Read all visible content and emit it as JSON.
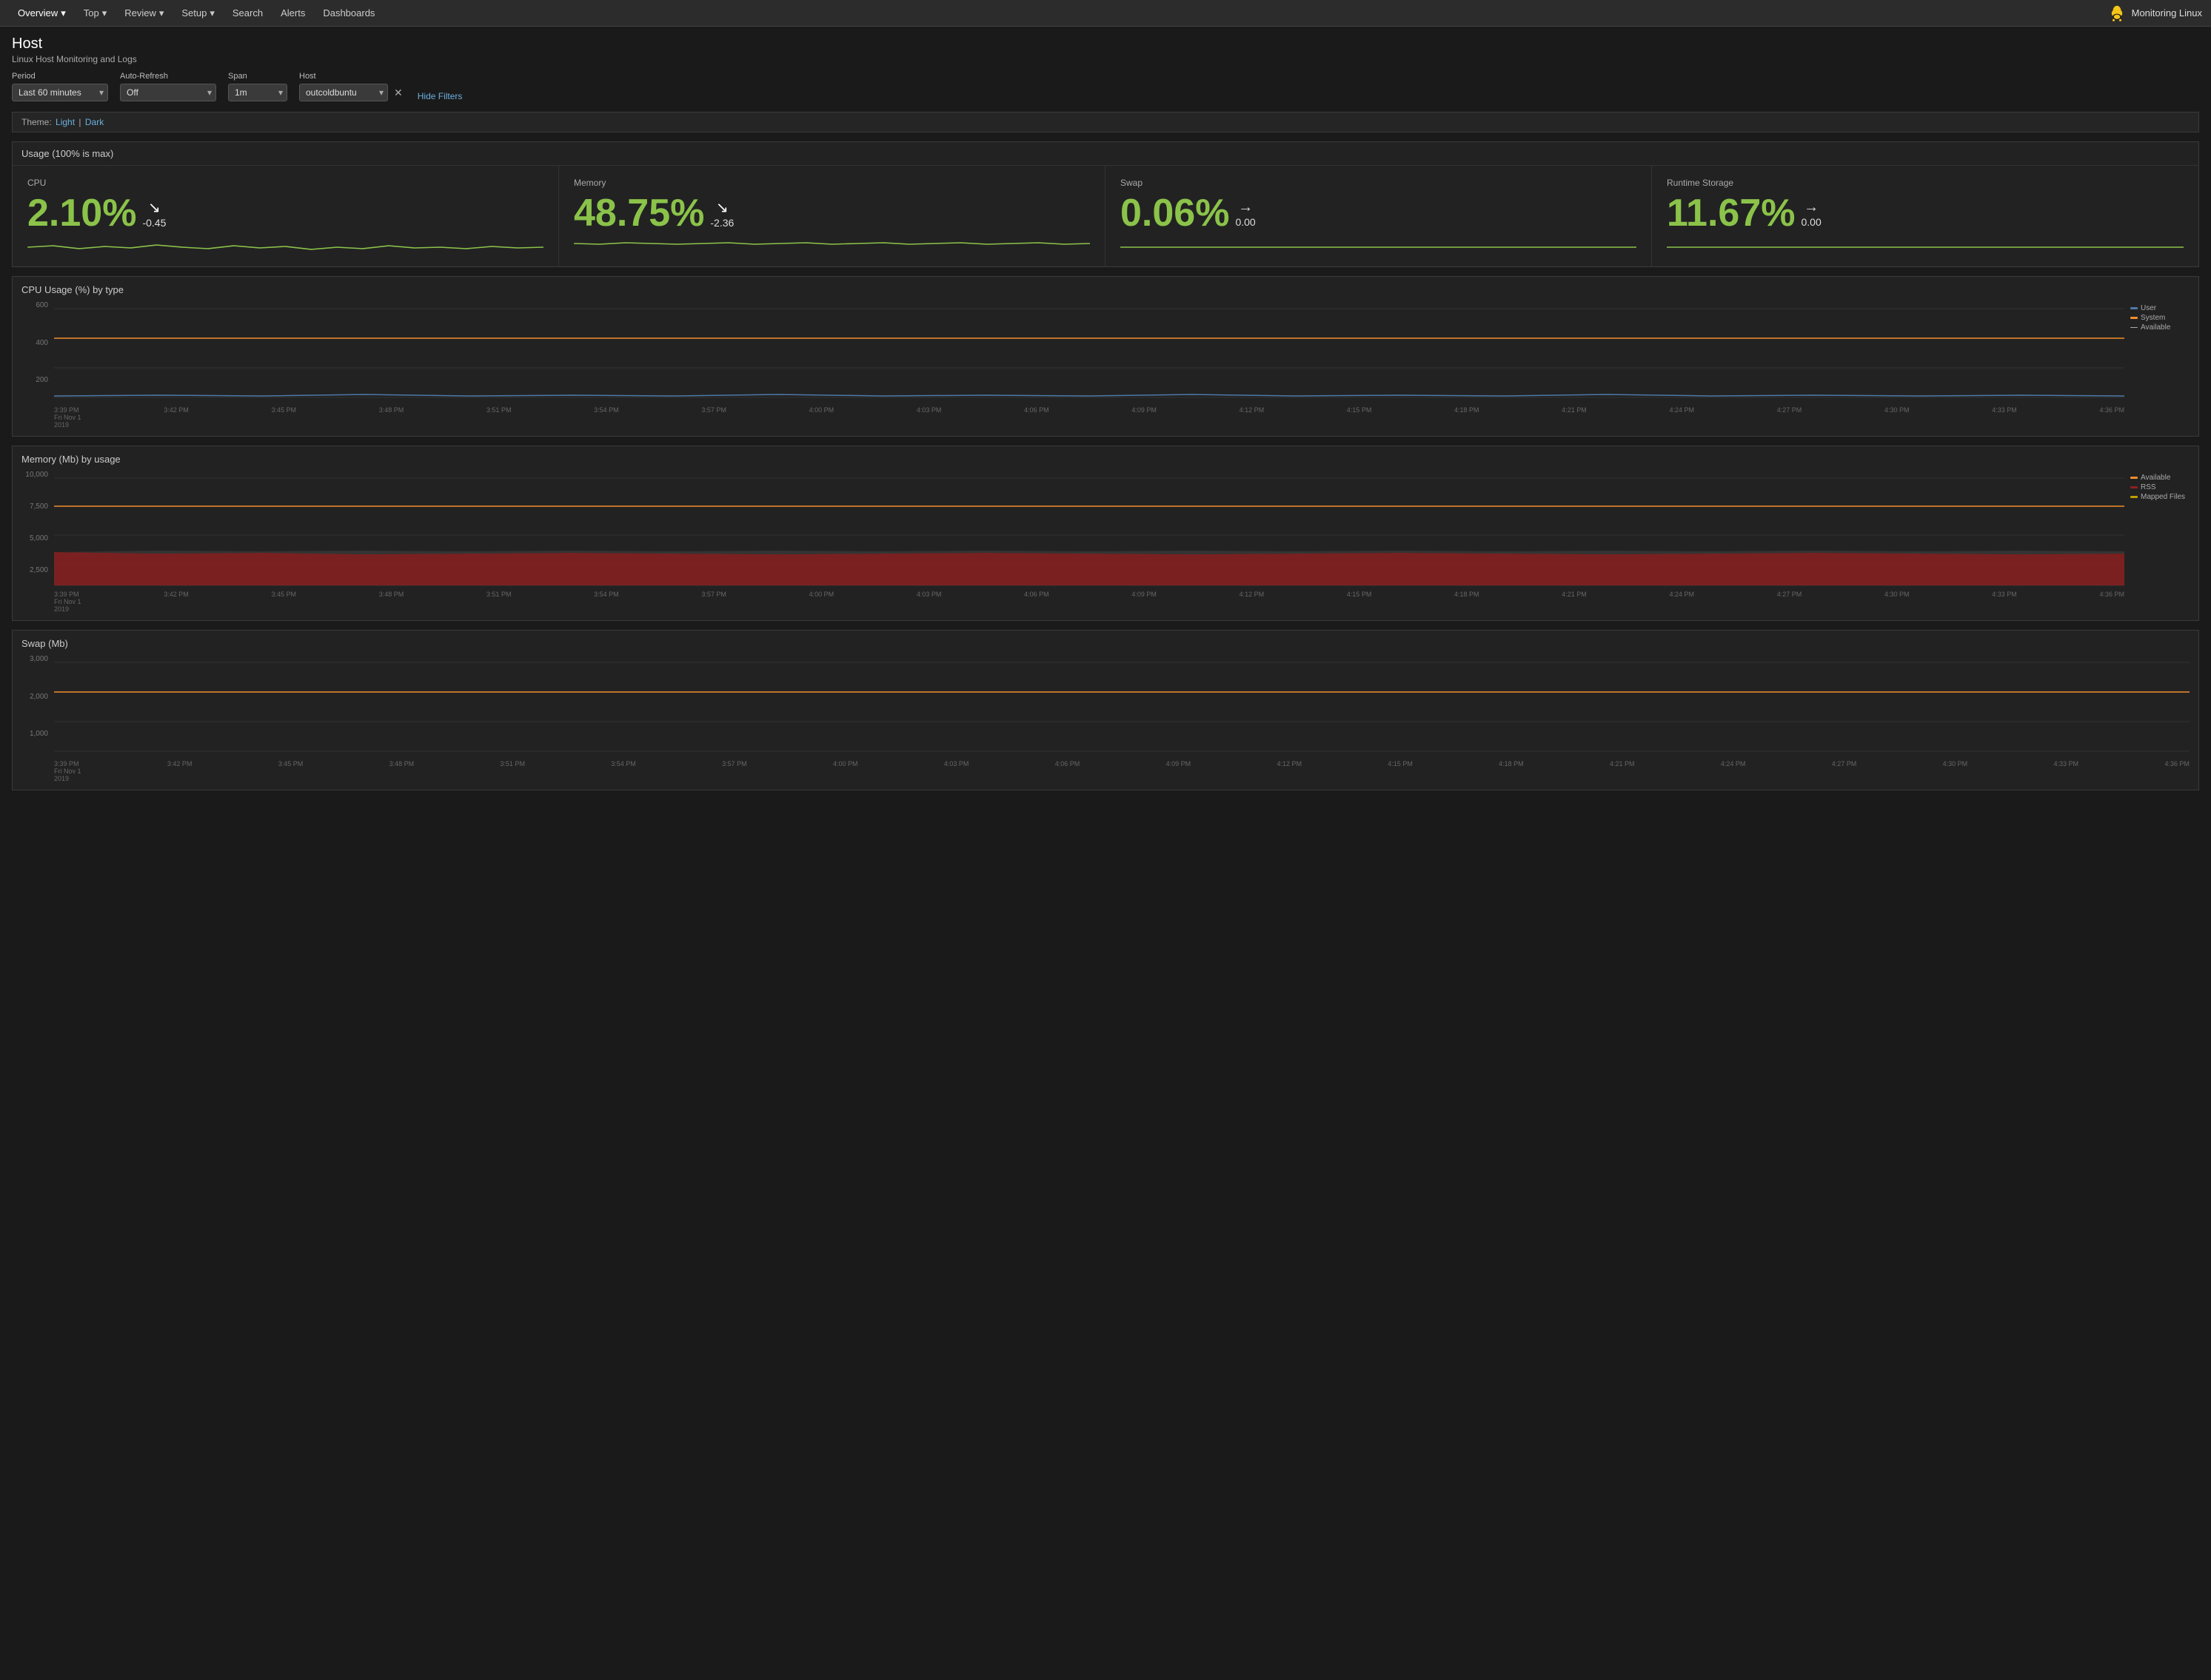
{
  "nav": {
    "items": [
      {
        "label": "Overview",
        "has_arrow": true
      },
      {
        "label": "Top",
        "has_arrow": true
      },
      {
        "label": "Review",
        "has_arrow": true
      },
      {
        "label": "Setup",
        "has_arrow": true
      },
      {
        "label": "Search",
        "has_arrow": false
      },
      {
        "label": "Alerts",
        "has_arrow": false
      },
      {
        "label": "Dashboards",
        "has_arrow": false
      }
    ],
    "brand_label": "Monitoring Linux"
  },
  "page": {
    "title": "Host",
    "subtitle": "Linux Host Monitoring and Logs"
  },
  "filters": {
    "period_label": "Period",
    "period_value": "Last 60 minutes",
    "autorefresh_label": "Auto-Refresh",
    "autorefresh_value": "Off",
    "span_label": "Span",
    "span_value": "1m",
    "host_label": "Host",
    "host_value": "outcoldbuntu",
    "hide_filters": "Hide Filters"
  },
  "theme": {
    "label": "Theme:",
    "light": "Light",
    "separator": "|",
    "dark": "Dark"
  },
  "usage": {
    "title": "Usage (100% is max)",
    "cells": [
      {
        "label": "CPU",
        "value": "2.10%",
        "delta": "-0.45",
        "arrow": "↘"
      },
      {
        "label": "Memory",
        "value": "48.75%",
        "delta": "-2.36",
        "arrow": "↘"
      },
      {
        "label": "Swap",
        "value": "0.06%",
        "delta": "0.00",
        "arrow": "→"
      },
      {
        "label": "Runtime Storage",
        "value": "11.67%",
        "delta": "0.00",
        "arrow": "→"
      }
    ]
  },
  "cpu_chart": {
    "title": "CPU Usage (%) by type",
    "y_labels": [
      "600",
      "400",
      "200",
      ""
    ],
    "x_labels": [
      "3:39 PM\nFri Nov 1\n2019",
      "3:42 PM",
      "3:45 PM",
      "3:48 PM",
      "3:51 PM",
      "3:54 PM",
      "3:57 PM",
      "4:00 PM",
      "4:03 PM",
      "4:06 PM",
      "4:09 PM",
      "4:12 PM",
      "4:15 PM",
      "4:18 PM",
      "4:21 PM",
      "4:24 PM",
      "4:27 PM",
      "4:30 PM",
      "4:33 PM",
      "4:36 PM"
    ],
    "legend": [
      {
        "label": "User",
        "color": "#4e79a7"
      },
      {
        "label": "System",
        "color": "#f28e2b"
      },
      {
        "label": "Available",
        "color": "#aaa",
        "dashed": true
      }
    ]
  },
  "memory_chart": {
    "title": "Memory (Mb) by usage",
    "y_labels": [
      "10,000",
      "7,500",
      "5,000",
      "2,500",
      ""
    ],
    "x_labels": [
      "3:39 PM\nFri Nov 1\n2019",
      "3:42 PM",
      "3:45 PM",
      "3:48 PM",
      "3:51 PM",
      "3:54 PM",
      "3:57 PM",
      "4:00 PM",
      "4:03 PM",
      "4:06 PM",
      "4:09 PM",
      "4:12 PM",
      "4:15 PM",
      "4:18 PM",
      "4:21 PM",
      "4:24 PM",
      "4:27 PM",
      "4:30 PM",
      "4:33 PM",
      "4:36 PM"
    ],
    "legend": [
      {
        "label": "Available",
        "color": "#f28e2b"
      },
      {
        "label": "RSS",
        "color": "#8b2020"
      },
      {
        "label": "Mapped Files",
        "color": "#c0a000"
      }
    ]
  },
  "swap_chart": {
    "title": "Swap (Mb)",
    "y_labels": [
      "3,000",
      "2,000",
      "1,000",
      ""
    ],
    "x_labels": [
      "3:39 PM\nFri Nov 1\n2019",
      "3:42 PM",
      "3:45 PM",
      "3:48 PM",
      "3:51 PM",
      "3:54 PM",
      "3:57 PM",
      "4:00 PM",
      "4:03 PM",
      "4:06 PM",
      "4:09 PM",
      "4:12 PM",
      "4:15 PM",
      "4:18 PM",
      "4:21 PM",
      "4:24 PM",
      "4:27 PM",
      "4:30 PM",
      "4:33 PM",
      "4:36 PM"
    ]
  },
  "colors": {
    "accent_green": "#8bc34a",
    "bg_dark": "#1a1a1a",
    "bg_panel": "#222222",
    "border": "#3a3a3a",
    "text_muted": "#777777"
  }
}
